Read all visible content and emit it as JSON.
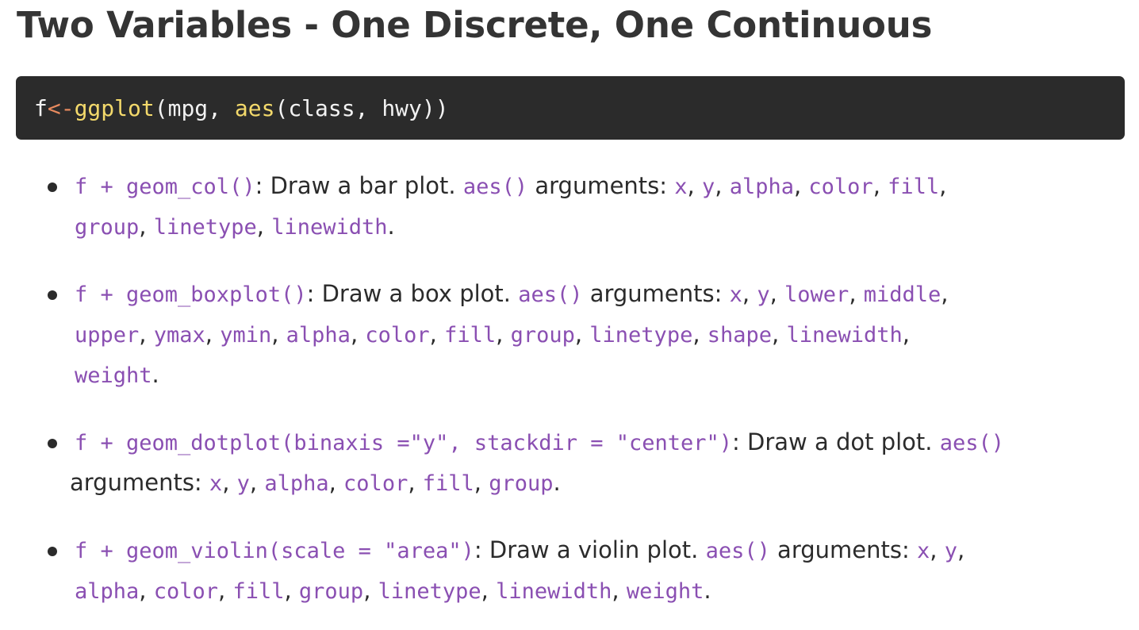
{
  "title": "Two Variables - One Discrete, One Continuous",
  "code_block": {
    "var": "f",
    "assign_op": "<-",
    "fn1": "ggplot",
    "open1": "(mpg, ",
    "fn2": "aes",
    "rest": "(class, hwy))"
  },
  "items": [
    {
      "call": "f + geom_col()",
      "desc": ": Draw a bar plot. ",
      "aes": "aes()",
      "args_label": " arguments: ",
      "args": [
        "x",
        "y",
        "alpha",
        "color",
        "fill",
        "group",
        "linetype",
        "linewidth"
      ]
    },
    {
      "call": "f + geom_boxplot()",
      "desc": ": Draw a box plot. ",
      "aes": "aes()",
      "args_label": " arguments: ",
      "args": [
        "x",
        "y",
        "lower",
        "middle",
        "upper",
        "ymax",
        "ymin",
        "alpha",
        "color",
        "fill",
        "group",
        "linetype",
        "shape",
        "linewidth",
        "weight"
      ]
    },
    {
      "call": "f + geom_dotplot(binaxis =\"y\", stackdir = \"center\")",
      "desc": ": Draw a dot plot. ",
      "aes": "aes()",
      "args_label": "arguments: ",
      "args": [
        "x",
        "y",
        "alpha",
        "color",
        "fill",
        "group"
      ]
    },
    {
      "call": "f + geom_violin(scale = \"area\")",
      "desc": ": Draw a violin plot. ",
      "aes": "aes()",
      "args_label": " arguments: ",
      "args": [
        "x",
        "y",
        "alpha",
        "color",
        "fill",
        "group",
        "linetype",
        "linewidth",
        "weight"
      ]
    }
  ]
}
